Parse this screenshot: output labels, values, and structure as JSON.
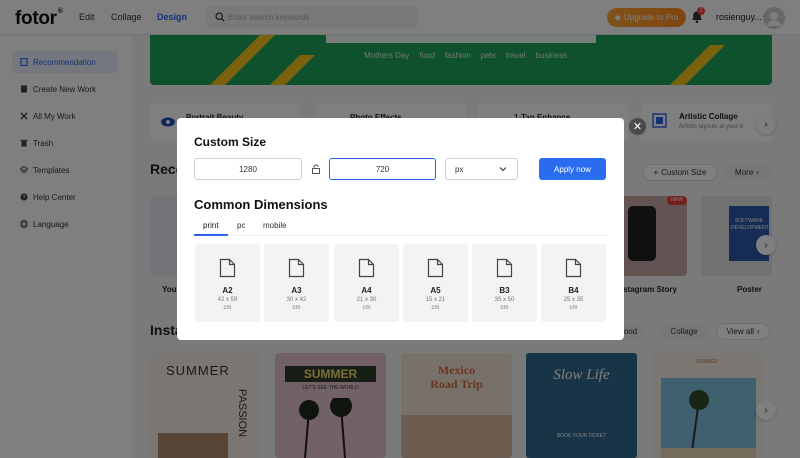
{
  "header": {
    "logo": "fotor",
    "logo_mark": "®",
    "nav": [
      "Edit",
      "Collage",
      "Design"
    ],
    "search_placeholder": "Enter search keywords",
    "upgrade_label": "Upgrade to Pro",
    "notification_count": "2",
    "username": "rosienguy..."
  },
  "sidebar": {
    "items": [
      {
        "label": "Recommendation",
        "icon": "bookmark-icon"
      },
      {
        "label": "Create New Work",
        "icon": "file-icon"
      },
      {
        "label": "All My Work",
        "icon": "tools-icon"
      },
      {
        "label": "Trash",
        "icon": "trash-icon"
      },
      {
        "label": "Templates",
        "icon": "layers-icon"
      },
      {
        "label": "Help Center",
        "icon": "help-icon"
      },
      {
        "label": "Language",
        "icon": "globe-icon"
      }
    ]
  },
  "banner": {
    "tags": [
      "Mothers Day",
      "food",
      "fashion",
      "pets",
      "travel",
      "business"
    ]
  },
  "categories": [
    {
      "title": "Portrait Beauty",
      "subtitle": ""
    },
    {
      "title": "Photo Effects",
      "subtitle": ""
    },
    {
      "title": "1-Tap Enhance",
      "subtitle": ""
    },
    {
      "title": "Artistic Collage",
      "subtitle": "Artistic layouts at your d"
    }
  ],
  "recommend": {
    "title_visible": "Reco",
    "custom_size_label": "Custom Size",
    "more_label": "More",
    "cards": [
      "You",
      "Instagram Story",
      "Poster"
    ],
    "new_badge": "NEW",
    "poster_text": "SOFTWARE DEVELOPMENT"
  },
  "instagram": {
    "title_visible": "Insta",
    "pills": [
      "Food",
      "Collage"
    ],
    "view_all_label": "View all",
    "templates": [
      {
        "line1": "SUMMER",
        "line2": "PASSION"
      },
      {
        "line1": "SUMMER",
        "line2": "LET'S SEE THE WORLD"
      },
      {
        "line1": "Mexico",
        "line2": "Road Trip"
      },
      {
        "line1": "Slow Life",
        "line2": "BOOK YOUR TICKET"
      },
      {
        "line1": "SUMMER",
        "line2": ""
      }
    ]
  },
  "modal": {
    "title": "Custom Size",
    "width_value": "1280",
    "height_value": "720",
    "unit": "px",
    "apply_label": "Apply now",
    "common_title": "Common Dimensions",
    "tabs": [
      "print",
      "pc",
      "mobile"
    ],
    "active_tab": "print",
    "dimensions": [
      {
        "name": "A2",
        "size": "42 x 59",
        "unit": "cm"
      },
      {
        "name": "A3",
        "size": "30 x 42",
        "unit": "cm"
      },
      {
        "name": "A4",
        "size": "21 x 30",
        "unit": "cm"
      },
      {
        "name": "A5",
        "size": "15 x 21",
        "unit": "cm"
      },
      {
        "name": "B3",
        "size": "35 x 50",
        "unit": "cm"
      },
      {
        "name": "B4",
        "size": "25 x 35",
        "unit": "cm"
      }
    ],
    "close_symbol": "✕"
  },
  "colors": {
    "accent": "#2a62e8",
    "upgrade": "#ff9a2b",
    "banner": "#1fa25a"
  }
}
